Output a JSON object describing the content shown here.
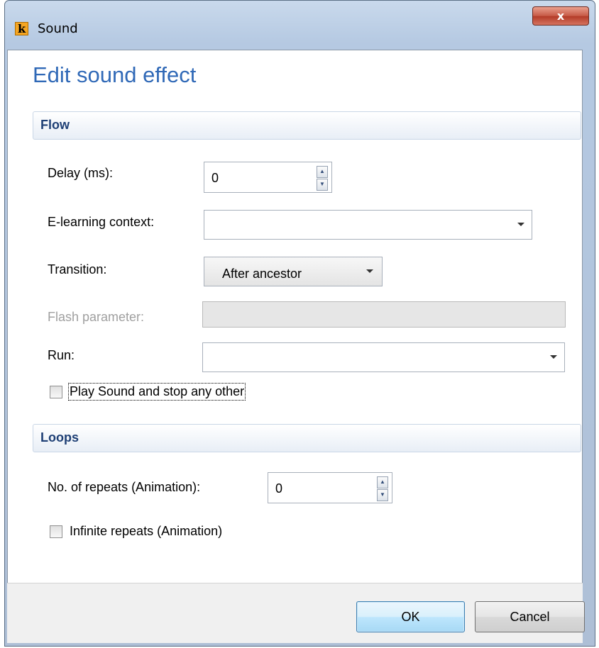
{
  "window": {
    "title": "Sound",
    "close_glyph": "x"
  },
  "app_icon": {
    "glyph": "k",
    "color": "#f5a623"
  },
  "heading": "Edit sound effect",
  "flow": {
    "section_label": "Flow",
    "delay_label": "Delay (ms):",
    "delay_value": "0",
    "elearning_label": "E-learning context:",
    "elearning_value": "",
    "transition_label": "Transition:",
    "transition_value": "After ancestor",
    "flash_label": "Flash parameter:",
    "flash_value": "",
    "run_label": "Run:",
    "run_value": "",
    "play_sound_label": "Play Sound and stop any other",
    "play_sound_checked": false
  },
  "loops": {
    "section_label": "Loops",
    "repeats_label": "No. of repeats (Animation):",
    "repeats_value": "0",
    "infinite_label": "Infinite repeats (Animation)",
    "infinite_checked": false
  },
  "buttons": {
    "ok": "OK",
    "cancel": "Cancel"
  },
  "colors": {
    "heading": "#3069b7",
    "section": "#1e3f75",
    "close": "#c75a46"
  }
}
